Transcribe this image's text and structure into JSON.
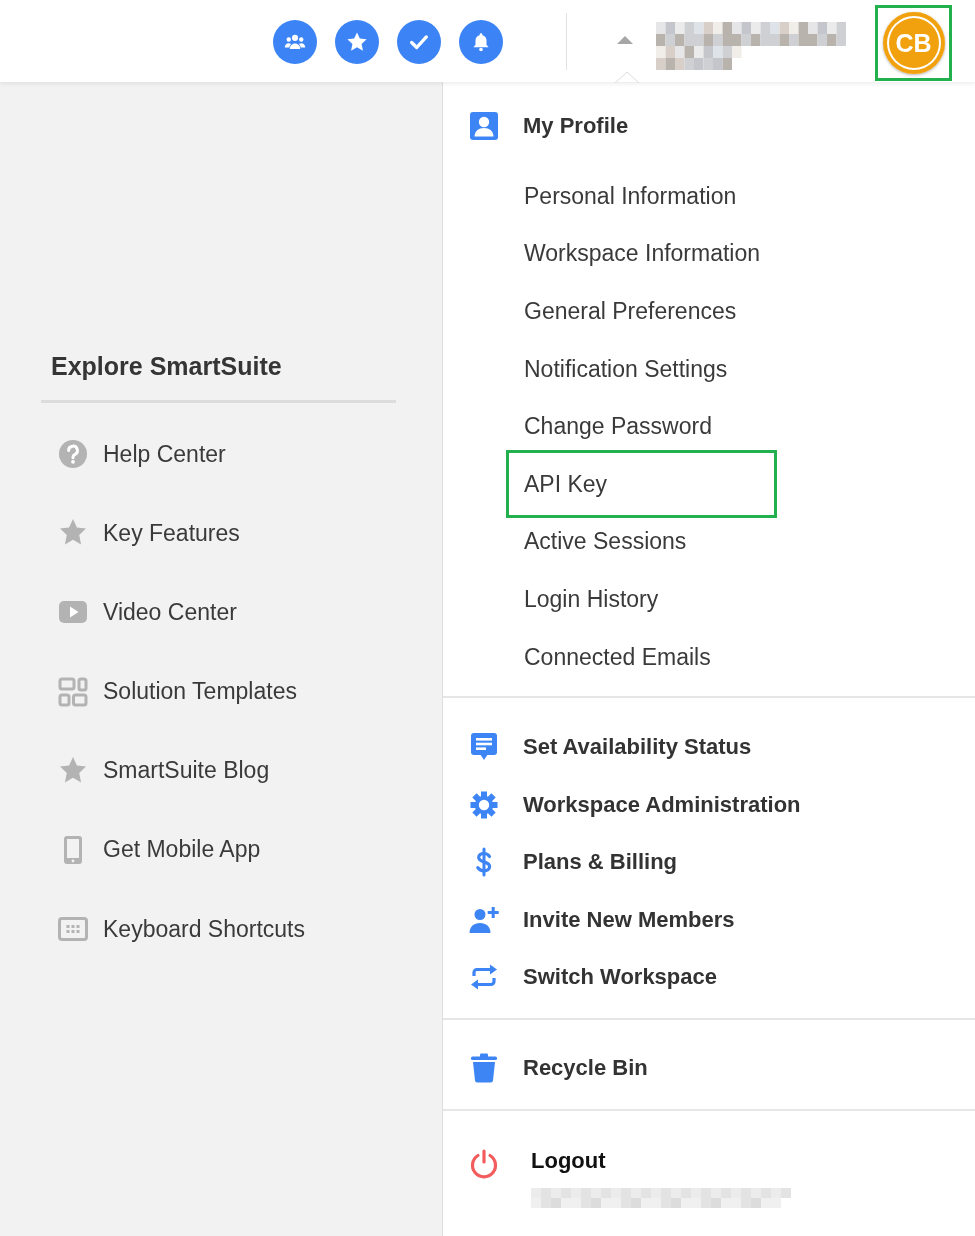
{
  "topbar": {
    "account": {
      "name_redacted": true,
      "initials": "CB",
      "highlighted": true
    }
  },
  "explore": {
    "title": "Explore SmartSuite",
    "items": [
      "Help Center",
      "Key Features",
      "Video Center",
      "Solution Templates",
      "SmartSuite Blog",
      "Get Mobile App",
      "Keyboard Shortcuts"
    ]
  },
  "profile_menu": {
    "header": "My Profile",
    "items": [
      {
        "label": "Personal Information",
        "highlighted": false
      },
      {
        "label": "Workspace Information",
        "highlighted": false
      },
      {
        "label": "General Preferences",
        "highlighted": false
      },
      {
        "label": "Notification Settings",
        "highlighted": false
      },
      {
        "label": "Change Password",
        "highlighted": false
      },
      {
        "label": "API Key",
        "highlighted": true
      },
      {
        "label": "Active Sessions",
        "highlighted": false
      },
      {
        "label": "Login History",
        "highlighted": false
      },
      {
        "label": "Connected Emails",
        "highlighted": false
      }
    ]
  },
  "workspace_menu": {
    "items": [
      "Set Availability Status",
      "Workspace Administration",
      "Plans & Billing",
      "Invite New Members",
      "Switch Workspace"
    ]
  },
  "recycle_bin": {
    "label": "Recycle Bin"
  },
  "logout": {
    "label": "Logout",
    "email_redacted": true
  }
}
